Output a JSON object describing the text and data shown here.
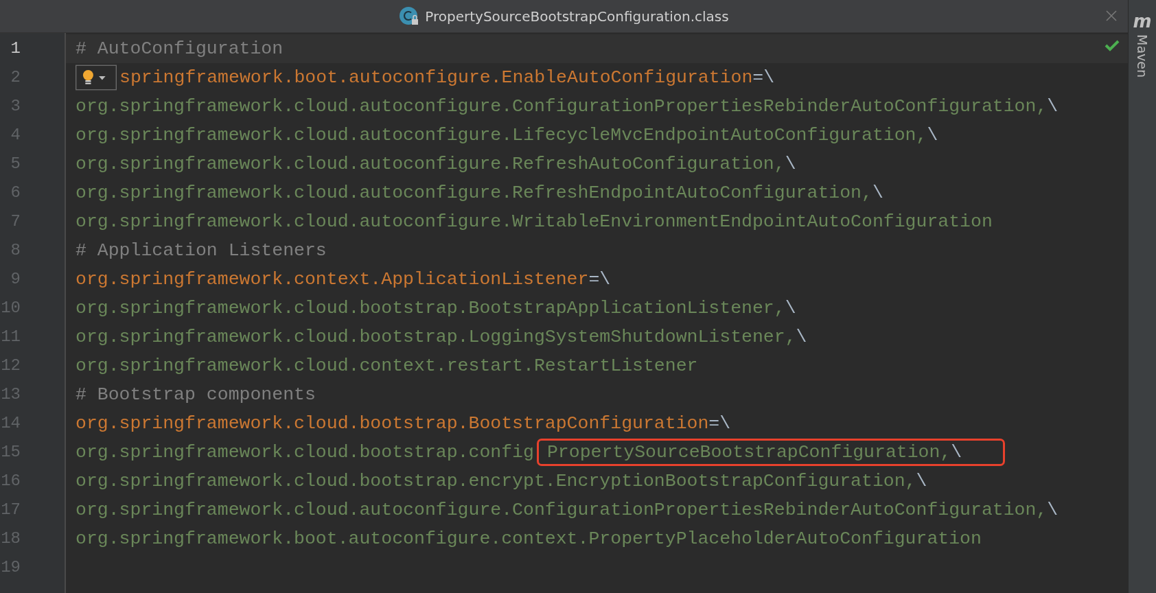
{
  "tab": {
    "title": "PropertySourceBootstrapConfiguration.class",
    "selected": true
  },
  "right_toolbar": {
    "logo": "m",
    "label": "Maven"
  },
  "lines": [
    {
      "number": "1",
      "kind": "comment",
      "text": "# AutoConfiguration",
      "current": true
    },
    {
      "number": "2",
      "kind": "key",
      "lightbulb": true,
      "text": "springframework.boot.autoconfigure.EnableAutoConfiguration",
      "tail": "=\\",
      "current": false
    },
    {
      "number": "3",
      "kind": "value",
      "text": "org.springframework.cloud.autoconfigure.ConfigurationPropertiesRebinderAutoConfiguration,",
      "tail": "\\",
      "current": false
    },
    {
      "number": "4",
      "kind": "value",
      "text": "org.springframework.cloud.autoconfigure.LifecycleMvcEndpointAutoConfiguration,",
      "tail": "\\",
      "current": false
    },
    {
      "number": "5",
      "kind": "value",
      "text": "org.springframework.cloud.autoconfigure.RefreshAutoConfiguration,",
      "tail": "\\",
      "current": false
    },
    {
      "number": "6",
      "kind": "value",
      "text": "org.springframework.cloud.autoconfigure.RefreshEndpointAutoConfiguration,",
      "tail": "\\",
      "current": false
    },
    {
      "number": "7",
      "kind": "value",
      "text": "org.springframework.cloud.autoconfigure.WritableEnvironmentEndpointAutoConfiguration",
      "current": false
    },
    {
      "number": "8",
      "kind": "comment",
      "text": "# Application Listeners",
      "current": false
    },
    {
      "number": "9",
      "kind": "key",
      "text": "org.springframework.context.ApplicationListener",
      "tail": "=\\",
      "current": false
    },
    {
      "number": "10",
      "kind": "value",
      "text": "org.springframework.cloud.bootstrap.BootstrapApplicationListener,",
      "tail": "\\",
      "current": false
    },
    {
      "number": "11",
      "kind": "value",
      "text": "org.springframework.cloud.bootstrap.LoggingSystemShutdownListener,",
      "tail": "\\",
      "current": false
    },
    {
      "number": "12",
      "kind": "value",
      "text": "org.springframework.cloud.context.restart.RestartListener",
      "current": false
    },
    {
      "number": "13",
      "kind": "comment",
      "text": "# Bootstrap components",
      "current": false
    },
    {
      "number": "14",
      "kind": "key",
      "text": "org.springframework.cloud.bootstrap.BootstrapConfiguration",
      "tail": "=\\",
      "current": false
    },
    {
      "number": "15",
      "kind": "value",
      "text": "org.springframework.cloud.bootstrap.config",
      "highlighted_text": "PropertySourceBootstrapConfiguration,",
      "tail": "\\",
      "current": false
    },
    {
      "number": "16",
      "kind": "value",
      "text": "org.springframework.cloud.bootstrap.encrypt.EncryptionBootstrapConfiguration,",
      "tail": "\\",
      "current": false
    },
    {
      "number": "17",
      "kind": "value",
      "text": "org.springframework.cloud.autoconfigure.ConfigurationPropertiesRebinderAutoConfiguration,",
      "tail": "\\",
      "current": false
    },
    {
      "number": "18",
      "kind": "value",
      "text": "org.springframework.boot.autoconfigure.context.PropertyPlaceholderAutoConfiguration",
      "current": false
    },
    {
      "number": "19",
      "kind": "empty",
      "current": false
    }
  ]
}
